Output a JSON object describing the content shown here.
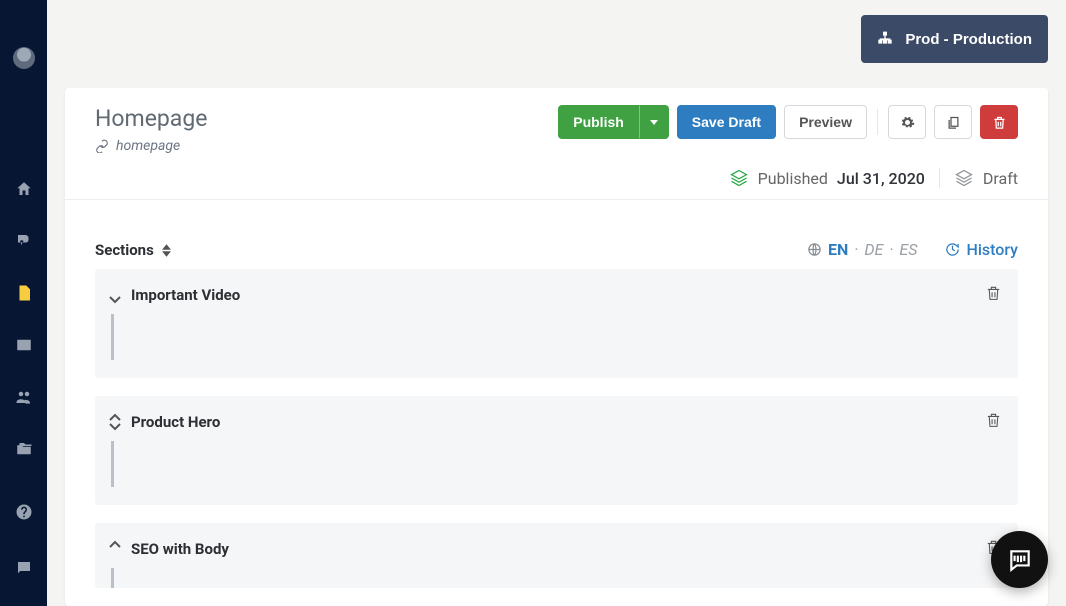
{
  "topbar": {
    "env_label": "Prod - Production"
  },
  "page": {
    "title": "Homepage",
    "slug": "homepage"
  },
  "actions": {
    "publish": "Publish",
    "save_draft": "Save Draft",
    "preview": "Preview"
  },
  "status": {
    "published_label": "Published",
    "published_date": "Jul 31, 2020",
    "draft_label": "Draft"
  },
  "body": {
    "sections_label": "Sections",
    "history_label": "History",
    "langs": {
      "active": "EN",
      "others": [
        "DE",
        "ES"
      ]
    }
  },
  "sections": [
    {
      "title": "Important Video",
      "can_up": false,
      "can_down": true
    },
    {
      "title": "Product Hero",
      "can_up": true,
      "can_down": true
    },
    {
      "title": "SEO with Body",
      "can_up": true,
      "can_down": false
    }
  ],
  "icons": {}
}
